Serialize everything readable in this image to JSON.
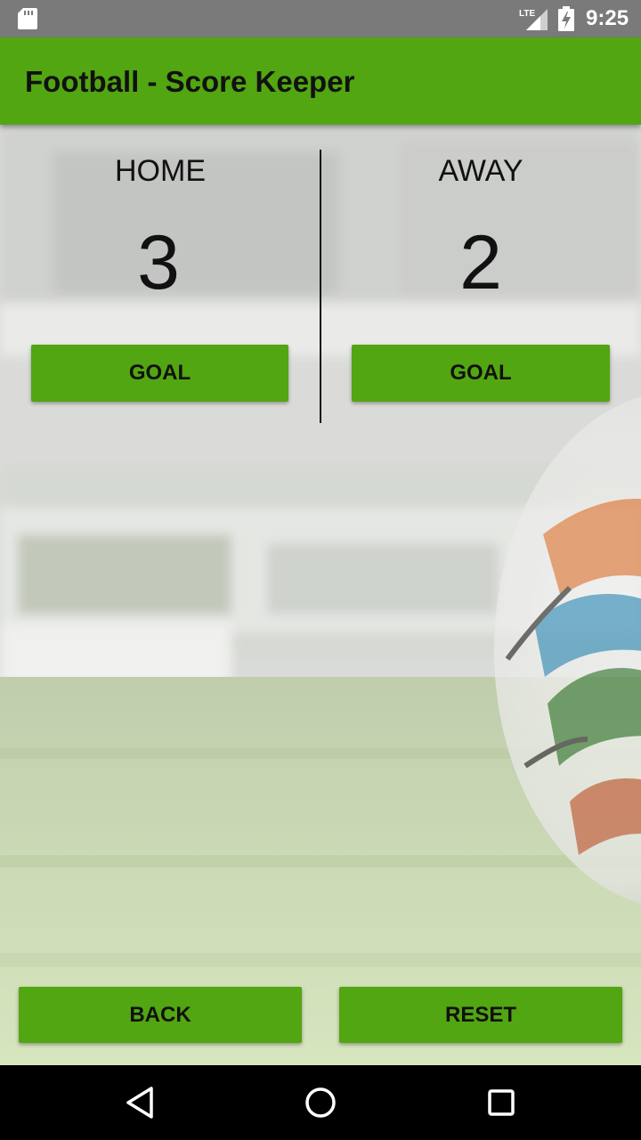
{
  "status_bar": {
    "time": "9:25",
    "network_label": "LTE",
    "icons": [
      "sd-card-icon",
      "signal-icon",
      "battery-charging-icon"
    ]
  },
  "app_bar": {
    "title": "Football - Score Keeper",
    "color": "#52a611"
  },
  "scoreboard": {
    "home": {
      "label": "HOME",
      "score": "3",
      "goal_label": "GOAL"
    },
    "away": {
      "label": "AWAY",
      "score": "2",
      "goal_label": "GOAL"
    }
  },
  "actions": {
    "back_label": "BACK",
    "reset_label": "RESET"
  },
  "nav_bar": {
    "icons": [
      "nav-back-icon",
      "nav-home-icon",
      "nav-recents-icon"
    ]
  },
  "colors": {
    "accent": "#52a611",
    "status_bar": "#7a7a7a",
    "nav_bar": "#000000"
  }
}
